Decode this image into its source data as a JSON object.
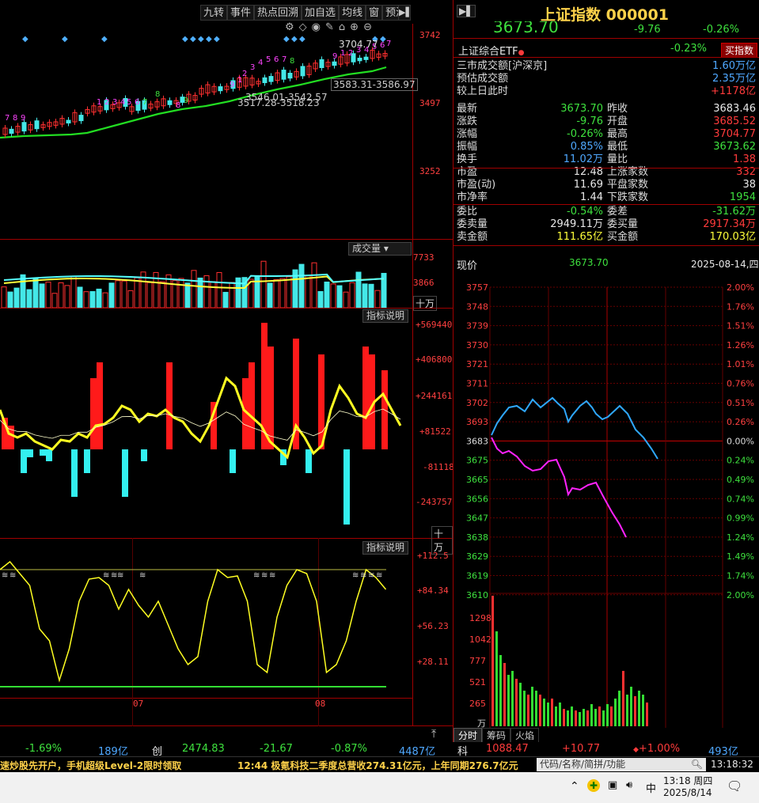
{
  "toolbar": {
    "items": [
      "九转",
      "事件",
      "热点回溯",
      "加自选",
      "均线",
      "窗",
      "预测"
    ]
  },
  "kline": {
    "price_axis": [
      "3742",
      "3497",
      "3252"
    ],
    "high_label": "3704.77",
    "box_labels": [
      "3583.31-3586.97",
      "3546.01-3542.57",
      "3517.28-3518.23"
    ],
    "nine_counts": [
      "7",
      "8",
      "9",
      "1",
      "2",
      "3",
      "4",
      "5",
      "6",
      "7",
      "8",
      "9",
      "1",
      "2",
      "3",
      "4",
      "5",
      "6",
      "7",
      "8",
      "9",
      "1",
      "2",
      "3",
      "4",
      "5",
      "6",
      "7",
      "8",
      "9"
    ]
  },
  "volume_panel": {
    "title": "成交量",
    "axis": [
      "7733",
      "3866"
    ],
    "unit": "十万"
  },
  "macd_panel": {
    "title": "指标说明",
    "axis": [
      "+569440",
      "+406800",
      "+244161",
      "+81522",
      "-81118",
      "-243757"
    ],
    "unit": "十万"
  },
  "kdj_panel": {
    "title": "指标说明",
    "axis": [
      "+112.5",
      "+84.34",
      "+56.23",
      "+28.11"
    ],
    "months": [
      "07",
      "08"
    ]
  },
  "quote": {
    "name": "上证指数",
    "code": "000001",
    "price_partial": "3673.70",
    "change": "-9.76",
    "change_pct": "-0.26%",
    "etf_label": "上证综合ETF",
    "etf_pct": "-0.23%",
    "buy_btn": "买指数",
    "turnover_label": "三市成交额[沪深京]",
    "turnover": "1.60万亿",
    "est_label": "预估成交额",
    "est": "2.35万亿",
    "vs_label": "较上日此时",
    "vs": "+1178亿"
  },
  "stats": [
    {
      "l": "最新",
      "lv": "3673.70",
      "lc": "grn",
      "r": "昨收",
      "rv": "3683.46",
      "rc": "wht"
    },
    {
      "l": "涨跌",
      "lv": "-9.76",
      "lc": "grn",
      "r": "开盘",
      "rv": "3685.52",
      "rc": "red"
    },
    {
      "l": "涨幅",
      "lv": "-0.26%",
      "lc": "grn",
      "r": "最高",
      "rv": "3704.77",
      "rc": "red"
    },
    {
      "l": "振幅",
      "lv": "0.85%",
      "lc": "blu",
      "r": "最低",
      "rv": "3673.62",
      "rc": "grn"
    },
    {
      "l": "换手",
      "lv": "11.02万",
      "lc": "blu",
      "r": "量比",
      "rv": "1.38",
      "rc": "red"
    },
    {
      "l": "市盈",
      "lv": "12.48",
      "lc": "wht",
      "r": "上涨家数",
      "rv": "332",
      "rc": "red"
    },
    {
      "l": "市盈(动)",
      "lv": "11.69",
      "lc": "wht",
      "r": "平盘家数",
      "rv": "38",
      "rc": "wht"
    },
    {
      "l": "市净率",
      "lv": "1.44",
      "lc": "wht",
      "r": "下跌家数",
      "rv": "1954",
      "rc": "grn"
    },
    {
      "l": "委比",
      "lv": "-0.54%",
      "lc": "grn",
      "r": "委差",
      "rv": "-31.62万",
      "rc": "grn"
    },
    {
      "l": "委卖量",
      "lv": "2949.11万",
      "lc": "wht",
      "r": "委买量",
      "rv": "2917.34万",
      "rc": "red"
    },
    {
      "l": "卖金额",
      "lv": "111.65亿",
      "lc": "yel",
      "r": "买金额",
      "rv": "170.03亿",
      "rc": "yel"
    }
  ],
  "intraday": {
    "label": "现价",
    "price": "3673.70",
    "date": "2025-08-14,四",
    "left_axis": [
      "3757",
      "3748",
      "3739",
      "3730",
      "3721",
      "3711",
      "3702",
      "3693",
      "3683",
      "3675",
      "3665",
      "3656",
      "3647",
      "3638",
      "3629",
      "3619",
      "3610"
    ],
    "right_axis": [
      "2.00%",
      "1.76%",
      "1.51%",
      "1.26%",
      "1.01%",
      "0.76%",
      "0.51%",
      "0.26%",
      "0.00%",
      "0.24%",
      "0.49%",
      "0.74%",
      "0.99%",
      "1.24%",
      "1.49%",
      "1.74%",
      "2.00%"
    ],
    "vol_axis": [
      "1298",
      "1042",
      "777",
      "521",
      "265"
    ],
    "vol_unit": "万",
    "tabs": [
      "分时",
      "筹码",
      "火焰"
    ]
  },
  "bottom": {
    "left_pct": "-1.69%",
    "left_amt": "189亿",
    "chuang_label": "创",
    "chuang_price": "2474.83",
    "chuang_chg": "-21.67",
    "chuang_pct": "-0.87%",
    "chuang_amt": "4487亿",
    "ke_label": "科",
    "ke_price": "1088.47",
    "ke_chg": "+10.77",
    "ke_pct": "+1.00%",
    "ke_amt": "493亿"
  },
  "ticker": {
    "left": "速炒股先开户，手机超级Level-2限时领取",
    "news": "12:44 极氪科技二季度总营收274.31亿元，上年同期276.7亿元",
    "search_placeholder": "代码/名称/简拼/功能",
    "clock": "13:18:32"
  },
  "taskbar": {
    "time": "13:18 周四",
    "date": "2025/8/14",
    "ime": "中"
  }
}
